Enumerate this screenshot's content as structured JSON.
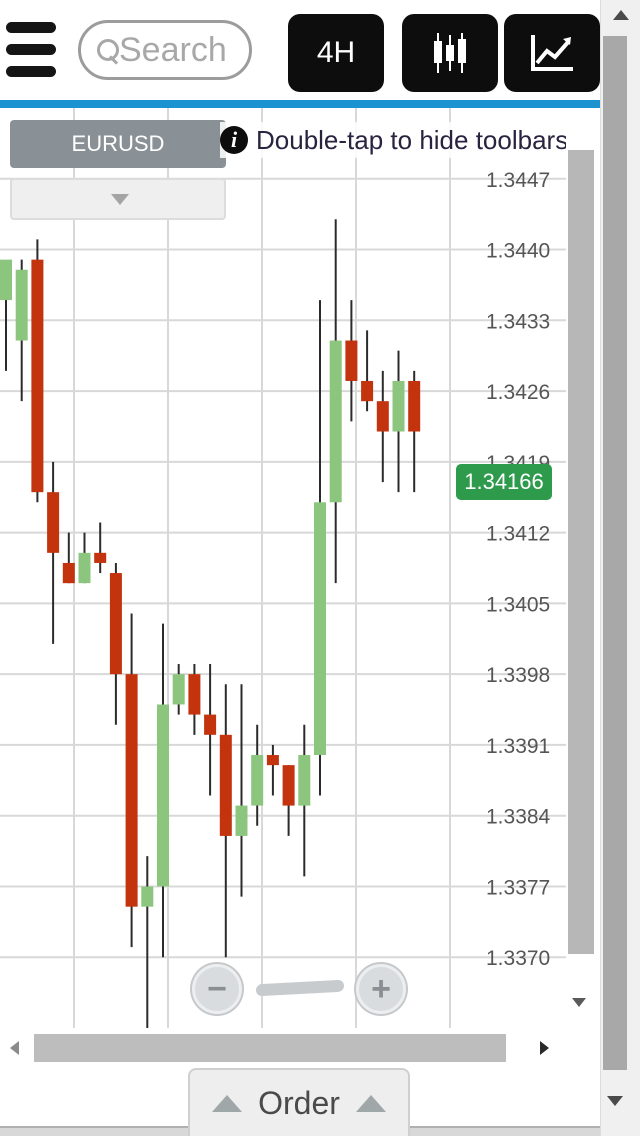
{
  "toolbar": {
    "menu_icon": "hamburger-menu-icon",
    "search": {
      "placeholder": "Search",
      "value": ""
    },
    "timeframe_label": "4H",
    "candles_icon": "candlestick-icon",
    "indicators_icon": "line-chart-icon"
  },
  "chart_header": {
    "symbol": "EURUSD",
    "hint": "Double-tap to hide toolbars",
    "current_price": "1.34166"
  },
  "zoom": {
    "minus_label": "−",
    "plus_label": "+"
  },
  "bottom": {
    "order_label": "Order"
  },
  "colors": {
    "accent": "#1c93d0",
    "bullish": "#8cc67e",
    "bearish": "#c2330e",
    "price_badge": "#2e9a4c"
  },
  "chart_data": {
    "type": "candlestick",
    "symbol": "EURUSD",
    "timeframe": "4H",
    "ylim": [
      1.3363,
      1.3454
    ],
    "y_ticks": [
      "1.3447",
      "1.3440",
      "1.3433",
      "1.3426",
      "1.3419",
      "1.3412",
      "1.3405",
      "1.3398",
      "1.3391",
      "1.3384",
      "1.3377",
      "1.3370"
    ],
    "y_tick_values": [
      1.3447,
      1.344,
      1.3433,
      1.3426,
      1.3419,
      1.3412,
      1.3405,
      1.3398,
      1.3391,
      1.3384,
      1.3377,
      1.337
    ],
    "grid": true,
    "current_price": 1.34166,
    "candles": [
      {
        "o": 1.3435,
        "h": 1.3436,
        "l": 1.3428,
        "c": 1.3439
      },
      {
        "o": 1.3431,
        "h": 1.3439,
        "l": 1.3425,
        "c": 1.3438
      },
      {
        "o": 1.3439,
        "h": 1.3441,
        "l": 1.3415,
        "c": 1.3416
      },
      {
        "o": 1.3416,
        "h": 1.3419,
        "l": 1.3401,
        "c": 1.341
      },
      {
        "o": 1.3409,
        "h": 1.3412,
        "l": 1.3407,
        "c": 1.3407
      },
      {
        "o": 1.3407,
        "h": 1.3412,
        "l": 1.3407,
        "c": 1.341
      },
      {
        "o": 1.341,
        "h": 1.3413,
        "l": 1.3408,
        "c": 1.3409
      },
      {
        "o": 1.3408,
        "h": 1.3409,
        "l": 1.3393,
        "c": 1.3398
      },
      {
        "o": 1.3398,
        "h": 1.3404,
        "l": 1.3371,
        "c": 1.3375
      },
      {
        "o": 1.3375,
        "h": 1.338,
        "l": 1.3363,
        "c": 1.3377
      },
      {
        "o": 1.3377,
        "h": 1.3403,
        "l": 1.337,
        "c": 1.3395
      },
      {
        "o": 1.3395,
        "h": 1.3399,
        "l": 1.3394,
        "c": 1.3398
      },
      {
        "o": 1.3398,
        "h": 1.3399,
        "l": 1.3392,
        "c": 1.3394
      },
      {
        "o": 1.3394,
        "h": 1.3399,
        "l": 1.3386,
        "c": 1.3392
      },
      {
        "o": 1.3392,
        "h": 1.3397,
        "l": 1.337,
        "c": 1.3382
      },
      {
        "o": 1.3382,
        "h": 1.3397,
        "l": 1.3376,
        "c": 1.3385
      },
      {
        "o": 1.3385,
        "h": 1.3393,
        "l": 1.3383,
        "c": 1.339
      },
      {
        "o": 1.339,
        "h": 1.3391,
        "l": 1.3386,
        "c": 1.3389
      },
      {
        "o": 1.3389,
        "h": 1.3389,
        "l": 1.3382,
        "c": 1.3385
      },
      {
        "o": 1.3385,
        "h": 1.3393,
        "l": 1.3378,
        "c": 1.339
      },
      {
        "o": 1.339,
        "h": 1.3435,
        "l": 1.3386,
        "c": 1.3415
      },
      {
        "o": 1.3415,
        "h": 1.3443,
        "l": 1.3407,
        "c": 1.3431
      },
      {
        "o": 1.3431,
        "h": 1.3435,
        "l": 1.3423,
        "c": 1.3427
      },
      {
        "o": 1.3427,
        "h": 1.3432,
        "l": 1.3424,
        "c": 1.3425
      },
      {
        "o": 1.3425,
        "h": 1.3428,
        "l": 1.3417,
        "c": 1.3422
      },
      {
        "o": 1.3422,
        "h": 1.343,
        "l": 1.3416,
        "c": 1.3427
      },
      {
        "o": 1.3427,
        "h": 1.3428,
        "l": 1.3416,
        "c": 1.3422
      }
    ]
  }
}
